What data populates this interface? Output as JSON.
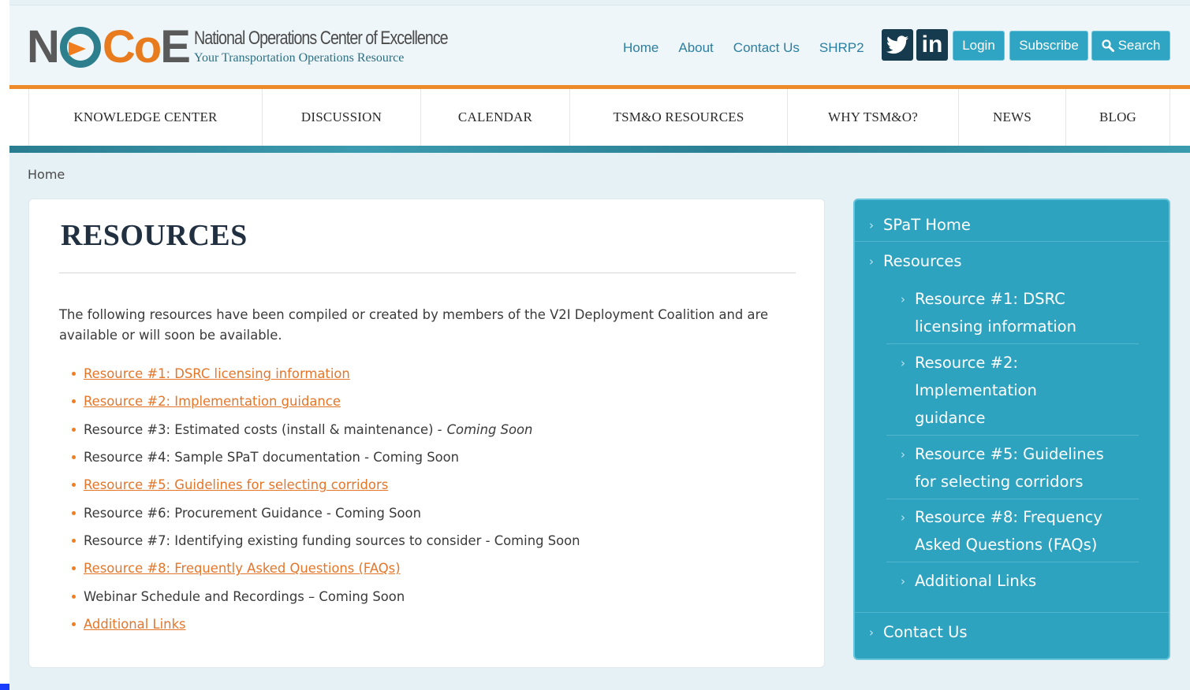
{
  "header": {
    "logo_initials_n": "N",
    "logo_initials_co": "Co",
    "logo_initials_e": "E",
    "logo_title": "National Operations Center of Excellence",
    "logo_tagline": "Your Transportation Operations Resource",
    "top_links": [
      "Home",
      "About",
      "Contact Us",
      "SHRP2"
    ],
    "twitter_icon": "twitter-icon",
    "linkedin_label": "in",
    "login_label": "Login",
    "subscribe_label": "Subscribe",
    "search_label": "Search",
    "accent_orange": "#ef8a2a",
    "accent_teal": "#2ea3c0"
  },
  "nav": {
    "items": [
      "KNOWLEDGE CENTER",
      "DISCUSSION",
      "CALENDAR",
      "TSM&O RESOURCES",
      "WHY TSM&O?",
      "NEWS",
      "BLOG"
    ]
  },
  "breadcrumb": {
    "home": "Home"
  },
  "main": {
    "title": "RESOURCES",
    "intro": "The following resources have been compiled or created by members of the V2I Deployment Coalition and are available or will soon be available.",
    "resources": [
      {
        "text": "Resource #1: DSRC licensing information",
        "link": true
      },
      {
        "text": "Resource #2: Implementation guidance",
        "link": true
      },
      {
        "text": "Resource #3: Estimated costs (install & maintenance) -",
        "suffix_italic": "Coming Soon",
        "link": false
      },
      {
        "text": "Resource #4: Sample SPaT documentation - Coming Soon",
        "link": false
      },
      {
        "text": "Resource #5: Guidelines for selecting corridors",
        "link": true
      },
      {
        "text": "Resource #6: Procurement Guidance - Coming Soon",
        "link": false
      },
      {
        "text": "Resource #7: Identifying existing funding sources to consider - Coming Soon",
        "link": false
      },
      {
        "text": "Resource #8: Frequently Asked Questions (FAQs)",
        "link": true
      },
      {
        "text": "Webinar Schedule and Recordings – Coming Soon",
        "link": false
      },
      {
        "text": "Additional Links",
        "link": true
      }
    ]
  },
  "sidebar": {
    "spat_home": "SPaT Home",
    "resources": "Resources",
    "sub_items": [
      [
        "Resource #1: DSRC",
        "licensing information"
      ],
      [
        "Resource #2:",
        "Implementation",
        "guidance"
      ],
      [
        "Resource #5: Guidelines",
        "for selecting corridors"
      ],
      [
        "Resource #8: Frequency",
        "Asked Questions (FAQs)"
      ],
      [
        "Additional Links"
      ]
    ],
    "contact": "Contact Us"
  }
}
